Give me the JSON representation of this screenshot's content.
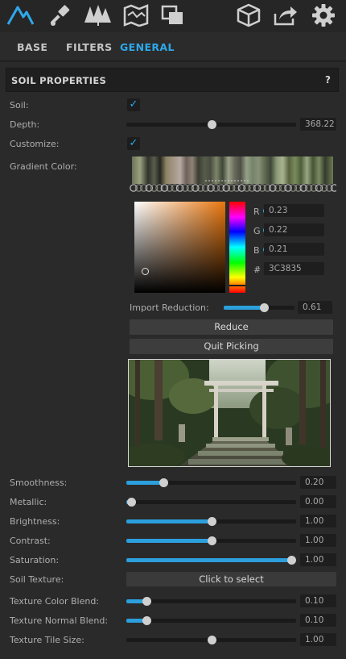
{
  "toolbar": {
    "icons": [
      "terrain-icon",
      "brush-icon",
      "trees-icon",
      "map-icon",
      "layers-icon",
      "cube-icon",
      "export-icon",
      "gear-icon"
    ],
    "accent": "#2ea8ea"
  },
  "tabs": [
    {
      "label": "BASE",
      "active": false
    },
    {
      "label": "FILTERS",
      "active": false
    },
    {
      "label": "GENERAL",
      "active": true
    }
  ],
  "section": {
    "title": "SOIL PROPERTIES",
    "help": "?"
  },
  "soil": {
    "label": "Soil:",
    "checked": true
  },
  "depth": {
    "label": "Depth:",
    "value": "368.22",
    "fraction": 0.5
  },
  "customize": {
    "label": "Customize:",
    "checked": true
  },
  "gradient": {
    "label": "Gradient Color:"
  },
  "picker": {
    "hex_symbol": "#",
    "hex": "3C3835",
    "channels": [
      {
        "label": "R",
        "value": "0.23",
        "fraction": 0.23
      },
      {
        "label": "G",
        "value": "0.22",
        "fraction": 0.22
      },
      {
        "label": "B",
        "value": "0.21",
        "fraction": 0.21
      }
    ]
  },
  "import_reduction": {
    "label": "Import Reduction:",
    "value": "0.61",
    "fraction": 0.57
  },
  "buttons": {
    "reduce": "Reduce",
    "quit": "Quit Picking"
  },
  "sliders": [
    {
      "id": "smoothness",
      "label": "Smoothness:",
      "value": "0.20",
      "fraction": 0.22
    },
    {
      "id": "metallic",
      "label": "Metallic:",
      "value": "0.00",
      "fraction": 0.03
    },
    {
      "id": "brightness",
      "label": "Brightness:",
      "value": "1.00",
      "fraction": 0.5
    },
    {
      "id": "contrast",
      "label": "Contrast:",
      "value": "1.00",
      "fraction": 0.5
    },
    {
      "id": "saturation",
      "label": "Saturation:",
      "value": "1.00",
      "fraction": 0.97
    }
  ],
  "soil_texture": {
    "label": "Soil Texture:",
    "button": "Click to select"
  },
  "texture_sliders": [
    {
      "id": "color-blend",
      "label": "Texture Color Blend:",
      "value": "0.10",
      "fraction": 0.12
    },
    {
      "id": "normal-blend",
      "label": "Texture Normal Blend:",
      "value": "0.10",
      "fraction": 0.12
    },
    {
      "id": "tile-size",
      "label": "Texture Tile Size:",
      "value": "1.00",
      "fraction": 0.5,
      "track_only": true
    }
  ]
}
